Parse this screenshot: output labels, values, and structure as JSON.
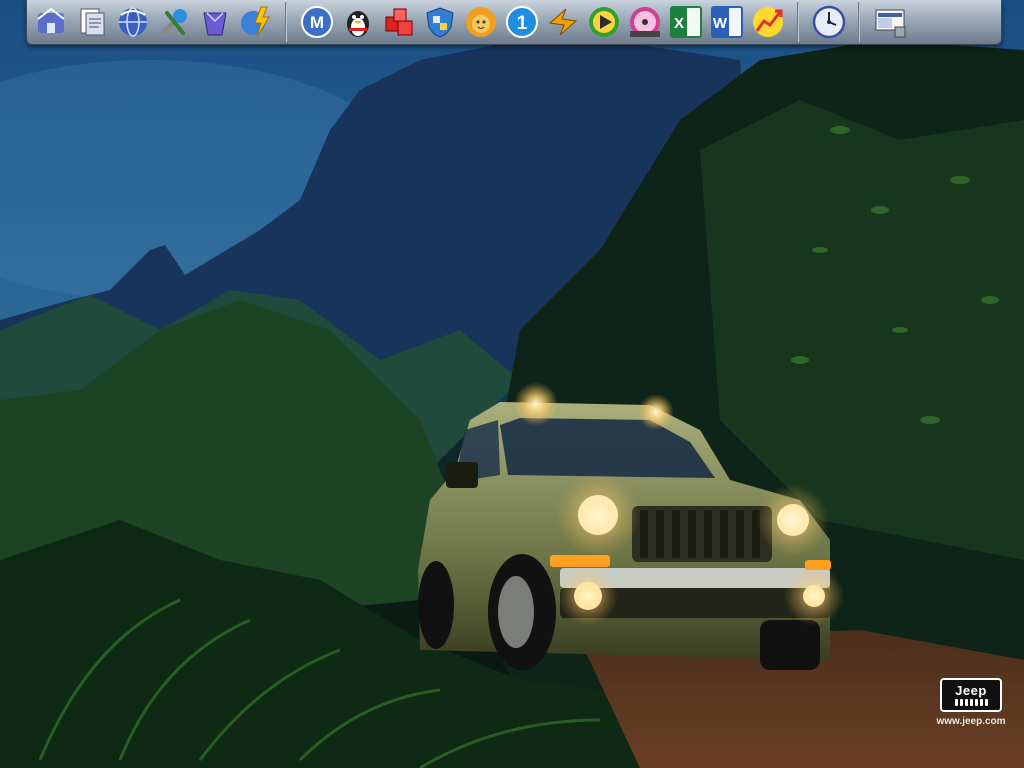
{
  "wallpaper": {
    "subject": "jeep-liberty-jungle",
    "logo_text": "Jeep",
    "logo_url": "www.jeep.com"
  },
  "dock": {
    "groups": [
      [
        {
          "name": "my-computer-icon",
          "glyph": "house",
          "color": "#5b6fc8"
        },
        {
          "name": "my-documents-icon",
          "glyph": "docs",
          "color": "#d8e0f0"
        },
        {
          "name": "internet-explorer-icon",
          "glyph": "globe",
          "color": "#3a5fc0"
        },
        {
          "name": "tools-icon",
          "glyph": "tools",
          "color": "#2d8fe0"
        },
        {
          "name": "recycle-bin-icon",
          "glyph": "bin",
          "color": "#6a5bd0"
        },
        {
          "name": "network-flash-icon",
          "glyph": "globe-bolt",
          "color": "#3b7fd8"
        }
      ],
      [
        {
          "name": "maxthon-browser-icon",
          "glyph": "M",
          "color": "#3d6fc7"
        },
        {
          "name": "qq-penguin-icon",
          "glyph": "penguin",
          "color": "#222222"
        },
        {
          "name": "cubes-app-icon",
          "glyph": "cubes",
          "color": "#e02020"
        },
        {
          "name": "security-shield-icon",
          "glyph": "shield",
          "color": "#2f7fd6"
        },
        {
          "name": "lion-app-icon",
          "glyph": "lion",
          "color": "#f0a020"
        },
        {
          "name": "number-one-app-icon",
          "glyph": "1",
          "color": "#1e8fe0"
        },
        {
          "name": "download-tool-icon",
          "glyph": "bolt",
          "color": "#f0a000"
        },
        {
          "name": "media-player-icon",
          "glyph": "play",
          "color": "#30a030"
        },
        {
          "name": "music-player-icon",
          "glyph": "disc",
          "color": "#d04090"
        },
        {
          "name": "excel-icon",
          "glyph": "X",
          "color": "#1f7f3f"
        },
        {
          "name": "word-icon",
          "glyph": "W",
          "color": "#2b5fb8"
        },
        {
          "name": "stock-chart-icon",
          "glyph": "chart",
          "color": "#e03030"
        }
      ],
      [
        {
          "name": "clock-icon",
          "glyph": "clock",
          "color": "#3a4fa0"
        }
      ],
      [
        {
          "name": "show-desktop-icon",
          "glyph": "desktop",
          "color": "#4060a0"
        }
      ]
    ]
  }
}
